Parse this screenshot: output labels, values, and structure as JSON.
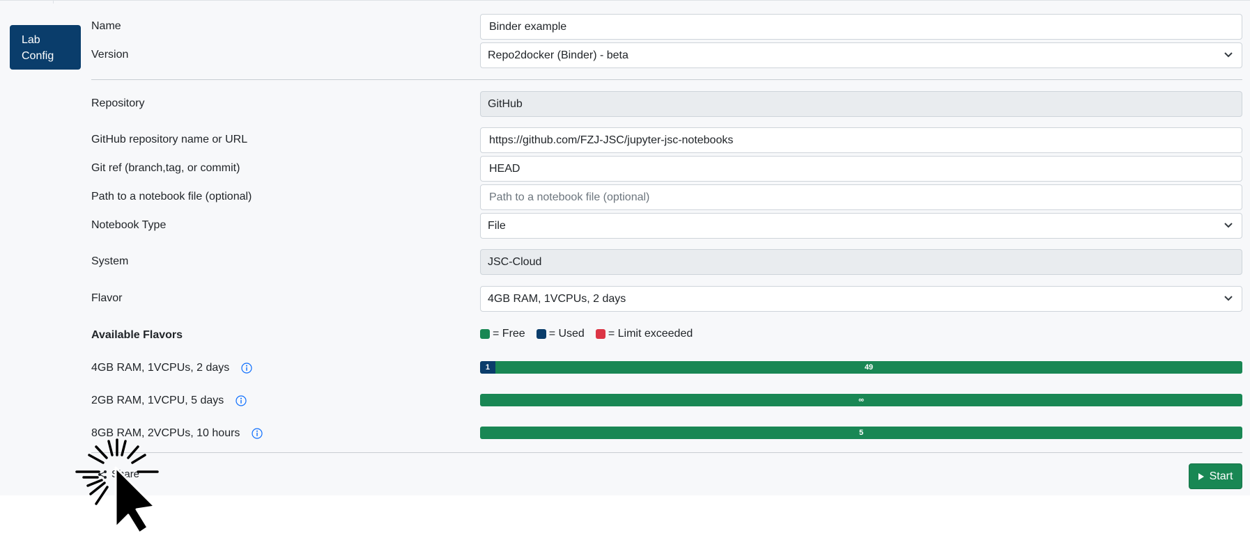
{
  "sidebar": {
    "tab_line1": "Lab",
    "tab_line2": "Config"
  },
  "form": {
    "name_label": "Name",
    "name_value": "Binder example",
    "version_label": "Version",
    "version_value": "Repo2docker (Binder) - beta",
    "repository_label": "Repository",
    "repository_value": "GitHub",
    "repo_url_label": "GitHub repository name or URL",
    "repo_url_value": "https://github.com/FZJ-JSC/jupyter-jsc-notebooks",
    "git_ref_label": "Git ref (branch,tag, or commit)",
    "git_ref_value": "HEAD",
    "notebook_path_label": "Path to a notebook file (optional)",
    "notebook_path_placeholder": "Path to a notebook file (optional)",
    "notebook_type_label": "Notebook Type",
    "notebook_type_value": "File",
    "system_label": "System",
    "system_value": "JSC-Cloud",
    "flavor_label": "Flavor",
    "flavor_value": "4GB RAM, 1VCPUs, 2 days"
  },
  "flavors": {
    "title": "Available Flavors",
    "legend": {
      "free": "= Free",
      "used": "= Used",
      "exceeded": "= Limit exceeded"
    },
    "colors": {
      "free": "#198754",
      "used": "#0a3d6b",
      "exceeded": "#dc3545"
    },
    "items": [
      {
        "label": "4GB RAM, 1VCPUs, 2 days",
        "used": "1",
        "free": "49",
        "used_fraction": 0.02
      },
      {
        "label": "2GB RAM, 1VCPU, 5 days",
        "used": "",
        "free": "∞",
        "used_fraction": 0
      },
      {
        "label": "8GB RAM, 2VCPUs, 10 hours",
        "used": "",
        "free": "5",
        "used_fraction": 0
      }
    ]
  },
  "footer": {
    "share_label": "Share",
    "start_label": "Start"
  },
  "icons": {
    "chevron": "chevron-down-icon",
    "info": "info-icon",
    "share": "share-icon",
    "play": "play-icon",
    "cursor": "click-cursor-icon"
  }
}
